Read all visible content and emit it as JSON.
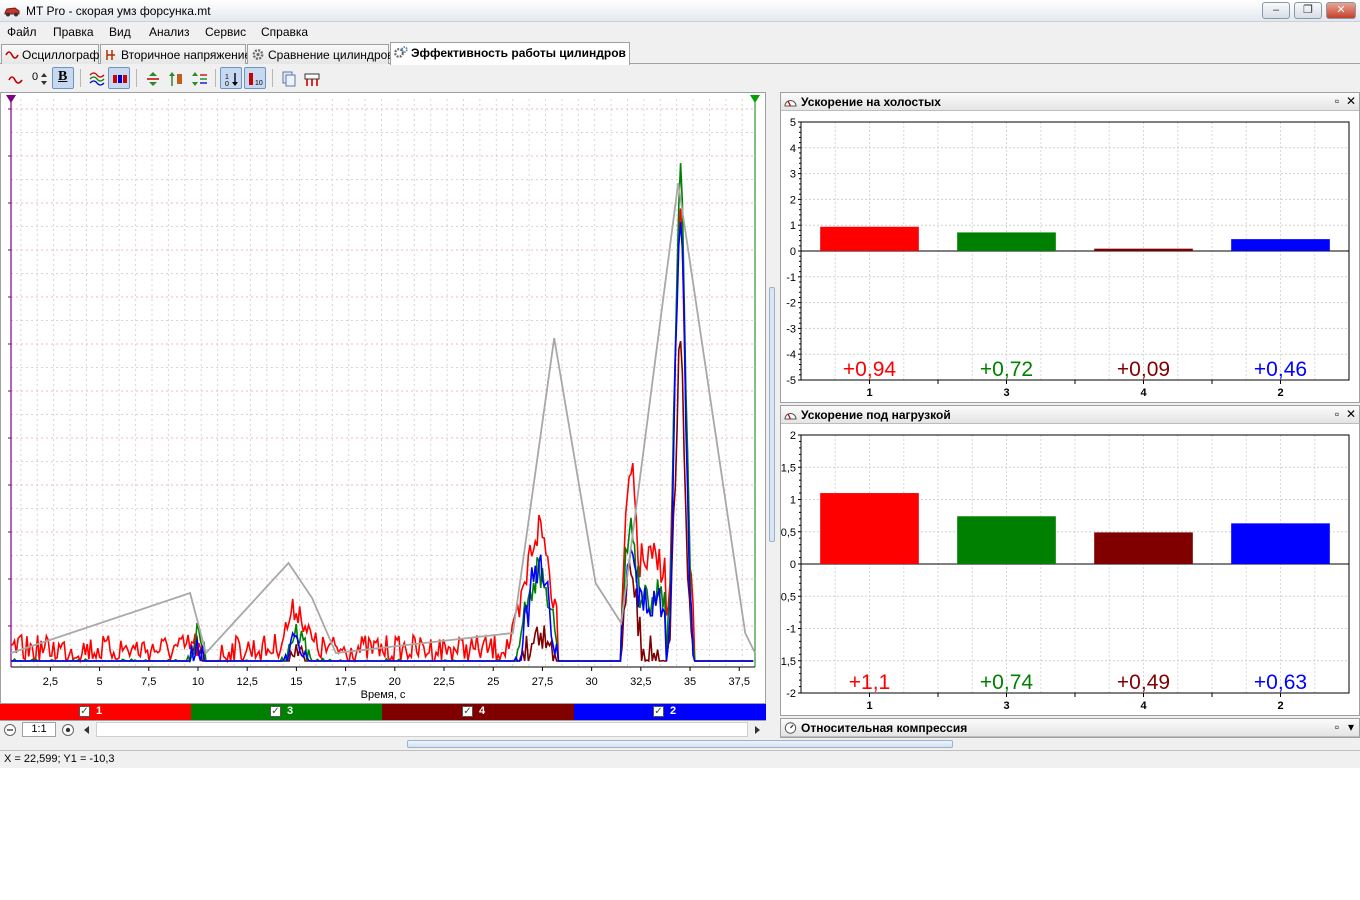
{
  "window": {
    "title": "MT Pro - скорая умз форсунка.mt",
    "controls": {
      "minimize": "‒",
      "restore": "❐",
      "close": "✕"
    }
  },
  "menu": [
    {
      "label": "Файл"
    },
    {
      "label": "Правка"
    },
    {
      "label": "Вид"
    },
    {
      "label": "Анализ"
    },
    {
      "label": "Сервис"
    },
    {
      "label": "Справка"
    }
  ],
  "tabs": [
    {
      "label": "Осциллограф",
      "icon": "waveform-icon",
      "active": false
    },
    {
      "label": "Вторичное напряжение",
      "icon": "ignition-icon",
      "active": false
    },
    {
      "label": "Сравнение цилиндров",
      "icon": "gear-icon",
      "active": false
    },
    {
      "label": "Эффективность работы цилиндров",
      "icon": "gears-icon",
      "active": true
    }
  ],
  "toolbar": {
    "offset_label": "0",
    "bold_label": "B"
  },
  "oscillogram": {
    "xlabel": "Время, с",
    "x_ticks": [
      "2,5",
      "5",
      "7,5",
      "10",
      "12,5",
      "15",
      "17,5",
      "20",
      "22,5",
      "25",
      "27,5",
      "30",
      "32,5",
      "35",
      "37,5"
    ],
    "x_tick_values": [
      2.5,
      5,
      7.5,
      10,
      12.5,
      15,
      17.5,
      20,
      22.5,
      25,
      27.5,
      30,
      32.5,
      35,
      37.5
    ],
    "xlim": [
      0.5,
      38.3
    ],
    "colors": {
      "red": "#ff0000",
      "green": "#008000",
      "darkred": "#800000",
      "blue": "#0000ff",
      "gray": "#a8a8a8"
    }
  },
  "channels": [
    {
      "label": "1",
      "color": "#ff0000",
      "checked": "✓"
    },
    {
      "label": "3",
      "color": "#008000",
      "checked": "✓"
    },
    {
      "label": "4",
      "color": "#800000",
      "checked": "✓"
    },
    {
      "label": "2",
      "color": "#0000ff",
      "checked": "✓"
    }
  ],
  "zoom": {
    "label": "1:1"
  },
  "panels": {
    "idle": {
      "title": "Ускорение на холостых"
    },
    "load": {
      "title": "Ускорение под нагрузкой"
    },
    "compression": {
      "title": "Относительная компрессия"
    }
  },
  "chart_data": [
    {
      "type": "bar",
      "title": "Ускорение на холостых",
      "categories": [
        "1",
        "3",
        "4",
        "2"
      ],
      "values": [
        0.94,
        0.72,
        0.09,
        0.46
      ],
      "value_labels": [
        "+0,94",
        "+0,72",
        "+0,09",
        "+0,46"
      ],
      "colors": [
        "#ff0000",
        "#008000",
        "#800000",
        "#0000ff"
      ],
      "ylim": [
        -5,
        5
      ],
      "y_ticks": [
        5,
        4,
        3,
        2,
        1,
        0,
        -1,
        -2,
        -3,
        -4,
        -5
      ],
      "y_tick_labels": [
        "5",
        "4",
        "3",
        "2",
        "1",
        "0",
        "-1",
        "-2",
        "-3",
        "-4",
        "-5"
      ],
      "grid": true
    },
    {
      "type": "bar",
      "title": "Ускорение под нагрузкой",
      "categories": [
        "1",
        "3",
        "4",
        "2"
      ],
      "values": [
        1.1,
        0.74,
        0.49,
        0.63
      ],
      "value_labels": [
        "+1,1",
        "+0,74",
        "+0,49",
        "+0,63"
      ],
      "colors": [
        "#ff0000",
        "#008000",
        "#800000",
        "#0000ff"
      ],
      "ylim": [
        -2,
        2
      ],
      "y_ticks": [
        2,
        1.5,
        1,
        0.5,
        0,
        -0.5,
        -1,
        -1.5,
        -2
      ],
      "y_tick_labels": [
        "2",
        "1,5",
        "1",
        "0,5",
        "0",
        "-0,5",
        "-1",
        "-1,5",
        "-2"
      ],
      "grid": true
    }
  ],
  "status": {
    "text": "X = 22,599; Y1 = -10,3"
  }
}
